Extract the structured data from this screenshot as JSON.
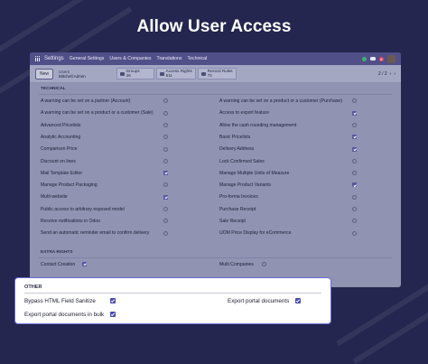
{
  "headline": "Allow User Access",
  "topbar": {
    "app": "Settings",
    "nav": [
      "General Settings",
      "Users & Companies",
      "Translations",
      "Technical"
    ],
    "badge": "8"
  },
  "controlbar": {
    "new_label": "New",
    "breadcrumb_parent": "Users",
    "breadcrumb_current": "Mitchell Admin",
    "stats": [
      {
        "label": "Groups",
        "value": "26"
      },
      {
        "label": "Access Rights",
        "value": "511"
      },
      {
        "label": "Record Rules",
        "value": "72"
      }
    ],
    "pager": "2 / 2",
    "prev": "‹",
    "next": "›"
  },
  "technical": {
    "title": "TECHNICAL",
    "left": [
      {
        "label": "A warning can be set on a partner (Account)",
        "checked": false
      },
      {
        "label": "A warning can be set on a product or a customer (Sale)",
        "checked": false
      },
      {
        "label": "Advanced Pricelists",
        "checked": false
      },
      {
        "label": "Analytic Accounting",
        "checked": false
      },
      {
        "label": "Comparison Price",
        "checked": false
      },
      {
        "label": "Discount on lines",
        "checked": false
      },
      {
        "label": "Mail Template Editor",
        "checked": true
      },
      {
        "label": "Manage Product Packaging",
        "checked": false
      },
      {
        "label": "Multi-website",
        "checked": true
      },
      {
        "label": "Public access to arbitrary exposed model",
        "checked": false
      },
      {
        "label": "Receive notifications in Odoo",
        "checked": false
      },
      {
        "label": "Send an automatic reminder email to confirm delivery",
        "checked": false
      }
    ],
    "right": [
      {
        "label": "A warning can be set on a product or a customer (Purchase)",
        "checked": false
      },
      {
        "label": "Access to export feature",
        "checked": true
      },
      {
        "label": "Allow the cash rounding management",
        "checked": false
      },
      {
        "label": "Basic Pricelists",
        "checked": true
      },
      {
        "label": "Delivery Address",
        "checked": true
      },
      {
        "label": "Lock Confirmed Sales",
        "checked": false
      },
      {
        "label": "Manage Multiple Units of Measure",
        "checked": false
      },
      {
        "label": "Manage Product Variants",
        "checked": true
      },
      {
        "label": "Pro-forma Invoices",
        "checked": false
      },
      {
        "label": "Purchase Receipt",
        "checked": false
      },
      {
        "label": "Sale Receipt",
        "checked": false
      },
      {
        "label": "UOM Price Display for eCommerce",
        "checked": false
      }
    ]
  },
  "extra_rights": {
    "title": "EXTRA RIGHTS",
    "left": {
      "label": "Contact Creation",
      "checked": true
    },
    "right": {
      "label": "Multi Companies",
      "checked": false
    }
  },
  "other": {
    "title": "OTHER",
    "items": [
      {
        "label": "Bypass HTML Field Sanitize",
        "checked": true
      },
      {
        "label": "Export portal documents",
        "checked": true
      },
      {
        "label": "Export portal documents in bulk",
        "checked": true
      }
    ]
  },
  "colors": {
    "background": "#24264f",
    "accent": "#4b4ab0",
    "overlay_border": "#6b6bd4"
  }
}
